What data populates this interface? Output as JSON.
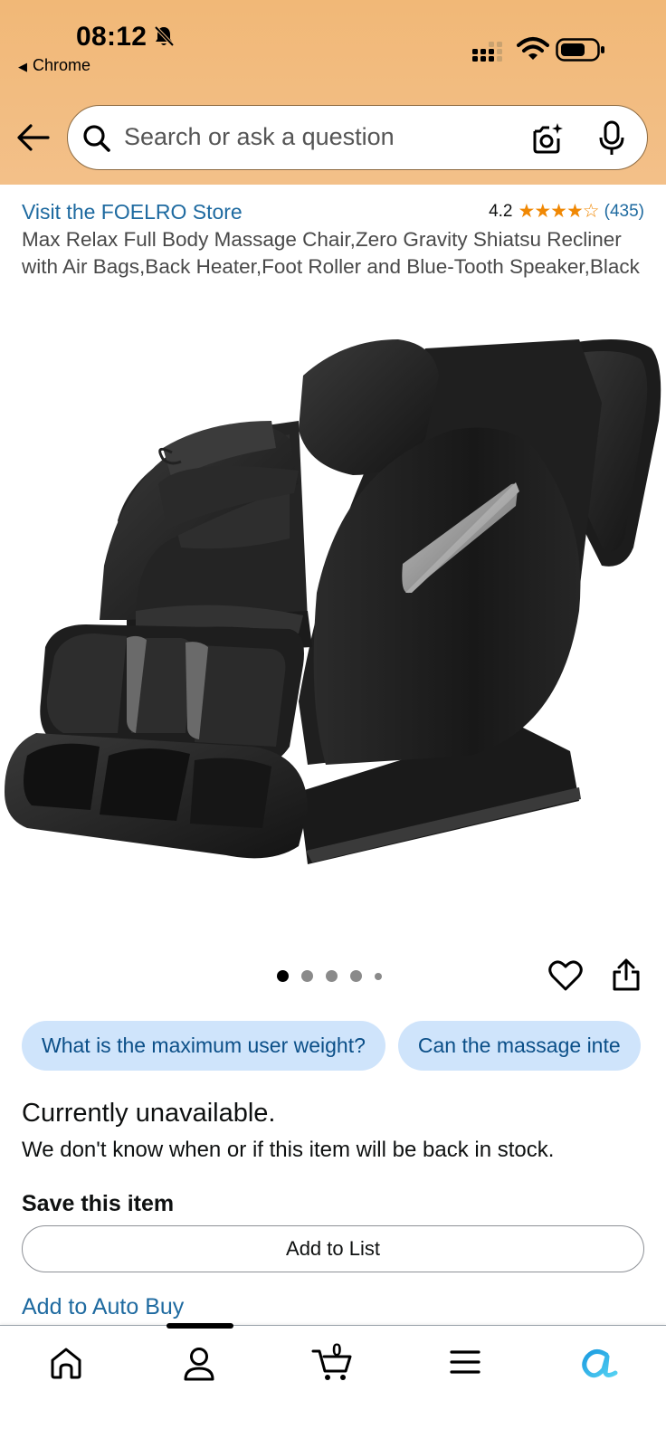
{
  "status_bar": {
    "time": "08:12",
    "back_app": "Chrome"
  },
  "search": {
    "placeholder": "Search or ask a question"
  },
  "product": {
    "store_link": "Visit the FOELRO Store",
    "rating_value": "4.2",
    "rating_stars": "★★★★☆",
    "rating_fraction": 0.84,
    "review_count": "(435)",
    "title": "Max Relax Full Body Massage Chair,Zero Gravity Shiatsu Recliner with Air Bags,Back Heater,Foot Roller and Blue-Tooth Speaker,Black"
  },
  "gallery": {
    "image_count": 5,
    "active_index": 0
  },
  "questions": [
    "What is the maximum user weight?",
    "Can the massage inte"
  ],
  "availability": {
    "status": "Currently unavailable.",
    "message": "We don't know when or if this item will be back in stock."
  },
  "save": {
    "title": "Save this item",
    "add_to_list": "Add to List",
    "auto_buy": "Add to Auto Buy"
  },
  "tabbar": {
    "cart_count": "0",
    "items": [
      "home-icon",
      "account-icon",
      "cart-icon",
      "menu-icon",
      "rufus-icon"
    ]
  },
  "colors": {
    "header_bg": "#f2bc80",
    "link_blue": "#1e6aa0",
    "star_orange": "#f08804",
    "chip_bg": "#cfe4fb"
  }
}
